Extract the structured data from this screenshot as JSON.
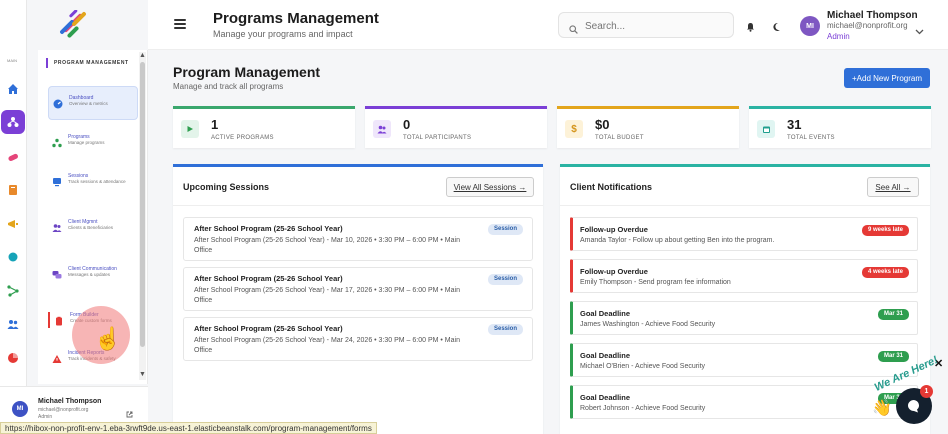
{
  "rail": {
    "label": "MAIN",
    "icons": [
      "home-icon",
      "programs-icon",
      "pill-icon",
      "book-icon",
      "megaphone-icon",
      "circle-icon",
      "network-icon",
      "users-icon",
      "pie-chart-icon"
    ]
  },
  "header": {
    "title": "Programs Management",
    "subtitle": "Manage your programs and impact",
    "search_placeholder": "Search...",
    "user": {
      "initials": "MI",
      "name": "Michael Thompson",
      "email": "michael@nonprofit.org",
      "role": "Admin"
    }
  },
  "sidebar": {
    "heading": "PROGRAM MANAGEMENT",
    "items": [
      {
        "title": "Dashboard",
        "sub": "Overview & metrics",
        "icon": "dashboard-icon"
      },
      {
        "title": "Programs",
        "sub": "Manage programs",
        "icon": "programs-icon"
      },
      {
        "title": "Sessions",
        "sub": "Track sessions & attendance",
        "icon": "sessions-icon"
      },
      {
        "title": "Client Mgmnt",
        "sub": "Clients & Beneficiaries",
        "icon": "clients-icon"
      },
      {
        "title": "Client Communication",
        "sub": "Messages & updates",
        "icon": "chat-icon"
      },
      {
        "title": "Form Builder",
        "sub": "Create custom forms",
        "icon": "clipboard-icon"
      },
      {
        "title": "Incident Reports",
        "sub": "Track incidents & safety",
        "icon": "warning-icon"
      }
    ],
    "footer": {
      "initials": "MI",
      "name": "Michael Thompson",
      "email": "michael@nonprofit.org",
      "role": "Admin"
    }
  },
  "main": {
    "title": "Program Management",
    "subtitle": "Manage and track all programs",
    "add_button": "+Add New Program",
    "stats": [
      {
        "value": "1",
        "label": "ACTIVE PROGRAMS",
        "color": "#3aa76d"
      },
      {
        "value": "0",
        "label": "TOTAL PARTICIPANTS",
        "color": "#7b3fd6"
      },
      {
        "value": "$0",
        "label": "TOTAL BUDGET",
        "color": "#e3a51c"
      },
      {
        "value": "31",
        "label": "TOTAL EVENTS",
        "color": "#2bb3a3"
      }
    ],
    "sessions_panel": {
      "title": "Upcoming Sessions",
      "button": "View All Sessions →",
      "items": [
        {
          "title": "After School Program (25-26 School Year)",
          "detail": "After School Program (25-26 School Year) - Mar 10, 2026 • 3:30 PM – 6:00 PM • Main Office",
          "badge": "Session"
        },
        {
          "title": "After School Program (25-26 School Year)",
          "detail": "After School Program (25-26 School Year) - Mar 17, 2026 • 3:30 PM – 6:00 PM • Main Office",
          "badge": "Session"
        },
        {
          "title": "After School Program (25-26 School Year)",
          "detail": "After School Program (25-26 School Year) - Mar 24, 2026 • 3:30 PM – 6:00 PM • Main Office",
          "badge": "Session"
        }
      ]
    },
    "notifications_panel": {
      "title": "Client Notifications",
      "button": "See All →",
      "items": [
        {
          "title": "Follow-up Overdue",
          "detail": "Amanda Taylor - Follow up about getting Ben into the program.",
          "badge": "9 weeks late",
          "color": "#e53935"
        },
        {
          "title": "Follow-up Overdue",
          "detail": "Emily Thompson - Send program fee information",
          "badge": "4 weeks late",
          "color": "#e53935"
        },
        {
          "title": "Goal Deadline",
          "detail": "James Washington - Achieve Food Security",
          "badge": "Mar 31",
          "color": "#2e9e4f"
        },
        {
          "title": "Goal Deadline",
          "detail": "Michael O'Brien - Achieve Food Security",
          "badge": "Mar 31",
          "color": "#2e9e4f"
        },
        {
          "title": "Goal Deadline",
          "detail": "Robert Johnson - Achieve Food Security",
          "badge": "Mar 31",
          "color": "#2e9e4f"
        }
      ]
    }
  },
  "status_url": "https://hibox-non-profit-env-1.eba-3rwft9de.us-east-1.elasticbeanstalk.com/program-management/forms",
  "chat": {
    "badge": "1",
    "text": "We Are Here!"
  }
}
